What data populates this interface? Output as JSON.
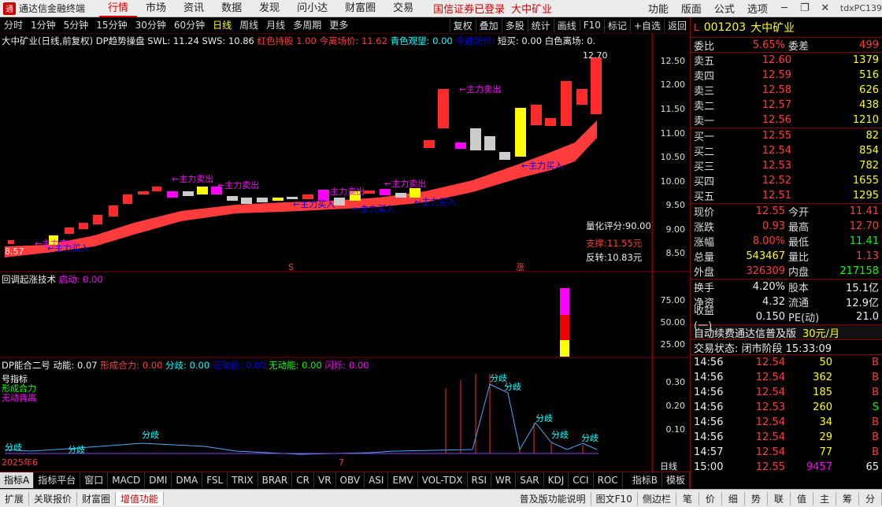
{
  "app": {
    "title": "通达信金融终端",
    "tdx": "tdxPC139",
    "login": "国信证券已登录",
    "current": "大中矿业"
  },
  "menu": [
    "行情",
    "市场",
    "资讯",
    "数据",
    "发现",
    "问小达",
    "财富圈",
    "交易"
  ],
  "menu_right": [
    "功能",
    "版面",
    "公式",
    "选项"
  ],
  "periods": [
    "分时",
    "1分钟",
    "5分钟",
    "15分钟",
    "30分钟",
    "60分钟",
    "日线",
    "周线",
    "月线",
    "多周期",
    "更多"
  ],
  "period_active": "日线",
  "tools": [
    "复权",
    "叠加",
    "多股",
    "统计",
    "画线",
    "F10",
    "标记",
    "+自选",
    "返回"
  ],
  "main_chart": {
    "title": "大中矿业(日线,前复权)",
    "indicator": "DP趋势操盘",
    "swl": "SWL: 11.24",
    "sws": "SWS: 10.86",
    "red_hold": "红色持股 1.00",
    "today_leave": "今离场价: 11.62",
    "cyan_watch": "青色观望: 0.00",
    "today_enter": "今进场价:",
    "short": "短买: 0.00",
    "white_leave": "白色离场: 0.",
    "high_label": "12.70",
    "low_label": "8.57",
    "quant": "量化评分:90.00",
    "support": "支撑:11.55元",
    "reversal": "反转:10.83元",
    "sell_label": "←主力卖出",
    "buy_label": "←主力买入",
    "y_ticks": [
      "12.50",
      "12.00",
      "11.50",
      "11.00",
      "10.50",
      "10.00",
      "9.50",
      "9.00",
      "8.50"
    ]
  },
  "panel2": {
    "title": "回调起涨技术",
    "start": "启动: 0.00",
    "y_ticks": [
      "75.00",
      "50.00",
      "25.00"
    ]
  },
  "panel3": {
    "title": "DP能合二号",
    "p1": "动能: 0.07",
    "p2": "形成合力: 0.00",
    "p3": "分歧: 0.00",
    "p4": "驱动能: 0.00",
    "p5": "无动能: 0.00",
    "p6": "闪烁: 0.00",
    "diverge": "分歧",
    "y_ticks": [
      "0.30",
      "0.20",
      "0.10"
    ]
  },
  "x_labels": {
    "year": "2025年6",
    "month": "7",
    "day_btn": "日线"
  },
  "bottom_tabs": [
    "指标A",
    "指标平台",
    "窗口",
    "MACD",
    "DMI",
    "DMA",
    "FSL",
    "TRIX",
    "BRAR",
    "CR",
    "VR",
    "OBV",
    "ASI",
    "EMV",
    "VOL-TDX",
    "RSI",
    "WR",
    "SAR",
    "KDJ",
    "CCI",
    "ROC"
  ],
  "bottom_right": [
    "指标B",
    "模板"
  ],
  "status_bar": [
    "扩展",
    "关联报价",
    "财富圈",
    "增值功能"
  ],
  "status_right": [
    "普及版功能说明",
    "图文F10",
    "侧边栏"
  ],
  "status_keys": [
    "笔",
    "价",
    "细",
    "势",
    "联",
    "值",
    "主",
    "筹",
    "分"
  ],
  "quote": {
    "code": "001203",
    "name": "大中矿业",
    "weibi_label": "委比",
    "weibi": "5.65%",
    "weicha_label": "委差",
    "weicha": "499",
    "asks": [
      [
        "卖五",
        "12.60",
        "1379"
      ],
      [
        "卖四",
        "12.59",
        "516"
      ],
      [
        "卖三",
        "12.58",
        "626"
      ],
      [
        "卖二",
        "12.57",
        "438"
      ],
      [
        "卖一",
        "12.56",
        "1210"
      ]
    ],
    "bids": [
      [
        "买一",
        "12.55",
        "82"
      ],
      [
        "买二",
        "12.54",
        "854"
      ],
      [
        "买三",
        "12.53",
        "782"
      ],
      [
        "买四",
        "12.52",
        "1655"
      ],
      [
        "买五",
        "12.51",
        "1295"
      ]
    ],
    "stats": [
      [
        "现价",
        "12.55",
        "今开",
        "11.41"
      ],
      [
        "涨跌",
        "0.93",
        "最高",
        "12.70"
      ],
      [
        "涨幅",
        "8.00%",
        "最低",
        "11.41"
      ],
      [
        "总量",
        "543467",
        "量比",
        "1.13"
      ],
      [
        "外盘",
        "326309",
        "内盘",
        "217158"
      ]
    ],
    "stats2": [
      [
        "换手",
        "4.20%",
        "股本",
        "15.1亿"
      ],
      [
        "净资",
        "4.32",
        "流通",
        "12.9亿"
      ],
      [
        "收益(一)",
        "0.150",
        "PE(动)",
        "21.0"
      ]
    ],
    "promo": "自动续费通达信普及版",
    "price_tag": "30元/月",
    "trade_status": "交易状态: 闭市阶段 15:33:09",
    "ticks": [
      [
        "14:56",
        "12.54",
        "50",
        "B"
      ],
      [
        "14:56",
        "12.54",
        "362",
        "B"
      ],
      [
        "14:56",
        "12.54",
        "185",
        "B"
      ],
      [
        "14:56",
        "12.53",
        "260",
        "S"
      ],
      [
        "14:56",
        "12.54",
        "34",
        "B"
      ],
      [
        "14:56",
        "12.54",
        "29",
        "B"
      ],
      [
        "14:57",
        "12.54",
        "77",
        "B"
      ],
      [
        "15:00",
        "12.55",
        "9457",
        "65"
      ]
    ]
  }
}
